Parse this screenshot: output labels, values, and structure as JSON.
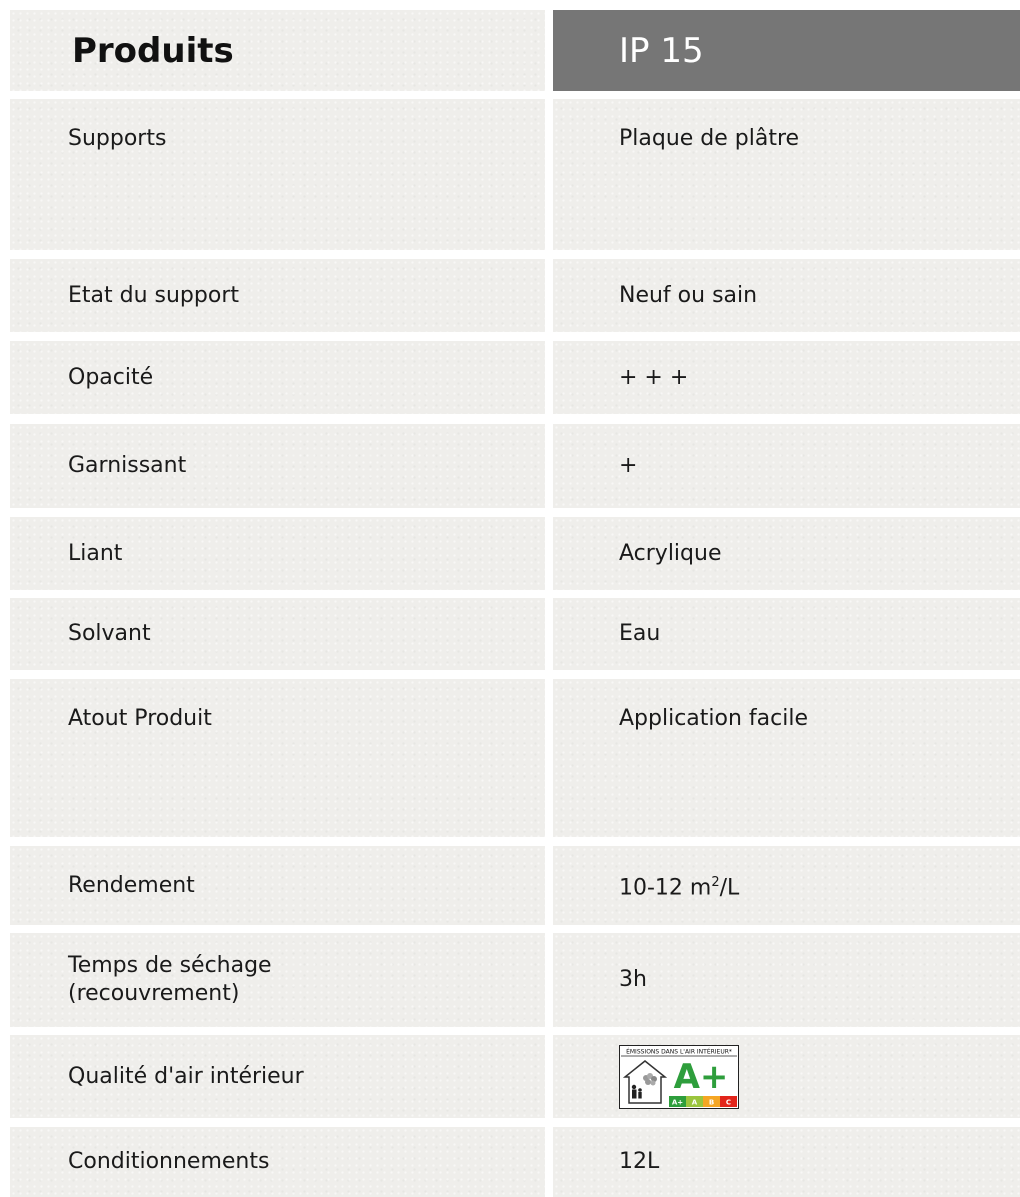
{
  "header": {
    "products_label": "Produits",
    "product_name": "IP 15"
  },
  "rows": [
    {
      "label": "Supports",
      "value": "Plaque de plâtre"
    },
    {
      "label": "Etat du support",
      "value": "Neuf ou sain"
    },
    {
      "label": "Opacité",
      "value": "+ + +"
    },
    {
      "label": "Garnissant",
      "value": "+"
    },
    {
      "label": "Liant",
      "value": "Acrylique"
    },
    {
      "label": "Solvant",
      "value": "Eau"
    },
    {
      "label": "Atout Produit",
      "value": "Application facile"
    },
    {
      "label": "Rendement",
      "value_main": "10-12 m",
      "value_sup": "2",
      "value_unit": "/L"
    },
    {
      "label_line1": "Temps de séchage",
      "label_line2": "(recouvrement)",
      "value": "3h"
    },
    {
      "label": "Qualité d'air intérieur",
      "badge": {
        "title": "ÉMISSIONS DANS L'AIR INTÉRIEUR*",
        "grade": "A+",
        "scale": [
          "A+",
          "A",
          "B",
          "C"
        ],
        "colors": {
          "A+": "#2e9e3c",
          "A": "#9bc53d",
          "B": "#f5a623",
          "C": "#e2241a"
        }
      }
    },
    {
      "label": "Conditionnements",
      "value": "12L"
    }
  ]
}
